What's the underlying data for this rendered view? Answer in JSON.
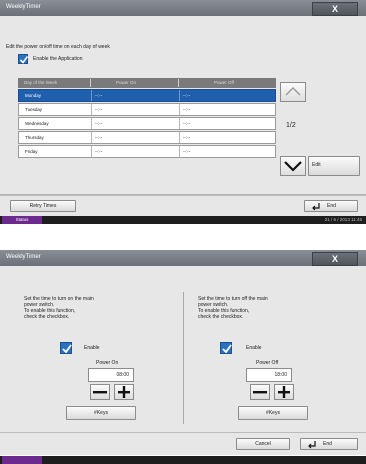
{
  "screen1": {
    "title": "WeeklyTimer",
    "close": "X",
    "instruction": "Edit the power on/off time on each day of week",
    "enable_application": "Enable the Application",
    "table": {
      "headers": [
        "Day of the Week",
        "Power On",
        "Power Off"
      ],
      "rows": [
        {
          "day": "Monday",
          "on": "--:--",
          "off": "--:--",
          "selected": true
        },
        {
          "day": "Tuesday",
          "on": "--:--",
          "off": "--:--"
        },
        {
          "day": "Wednesday",
          "on": "--:--",
          "off": "--:--"
        },
        {
          "day": "Thursday",
          "on": "--:--",
          "off": "--:--"
        },
        {
          "day": "Friday",
          "on": "--:--",
          "off": "--:--"
        }
      ]
    },
    "page": "1/2",
    "edit_label": "Edit",
    "retry_label": "Retry Times",
    "end_label": "End",
    "status_label": "Status",
    "datetime": "21 / 6 / 2013 11:45"
  },
  "screen2": {
    "title": "WeeklyTimer",
    "close": "X",
    "left": {
      "instruction_lines": [
        "Set the time to turn on the main",
        "power switch.",
        "To enable this function,",
        "check the checkbox."
      ],
      "enable_label": "Enable",
      "field_label": "Power On",
      "value": "08:00",
      "keys_label": "#Keys"
    },
    "right": {
      "instruction_lines": [
        "Set the time to turn off the main",
        "power switch.",
        "To enable this function,",
        "check the checkbox."
      ],
      "enable_label": "Enable",
      "field_label": "Power Off",
      "value": "18:00",
      "keys_label": "#Keys"
    },
    "cancel_label": "Cancel",
    "end_label": "End"
  },
  "colors": {
    "selection": "#1e5fae",
    "checkbox": "#2a70c3",
    "status_tab": "#6d2a8e",
    "titlebar": "#7a7f87"
  },
  "icons": [
    "check-icon",
    "scroll-up-icon",
    "scroll-down-icon",
    "enter-icon",
    "minus-icon",
    "plus-icon"
  ]
}
